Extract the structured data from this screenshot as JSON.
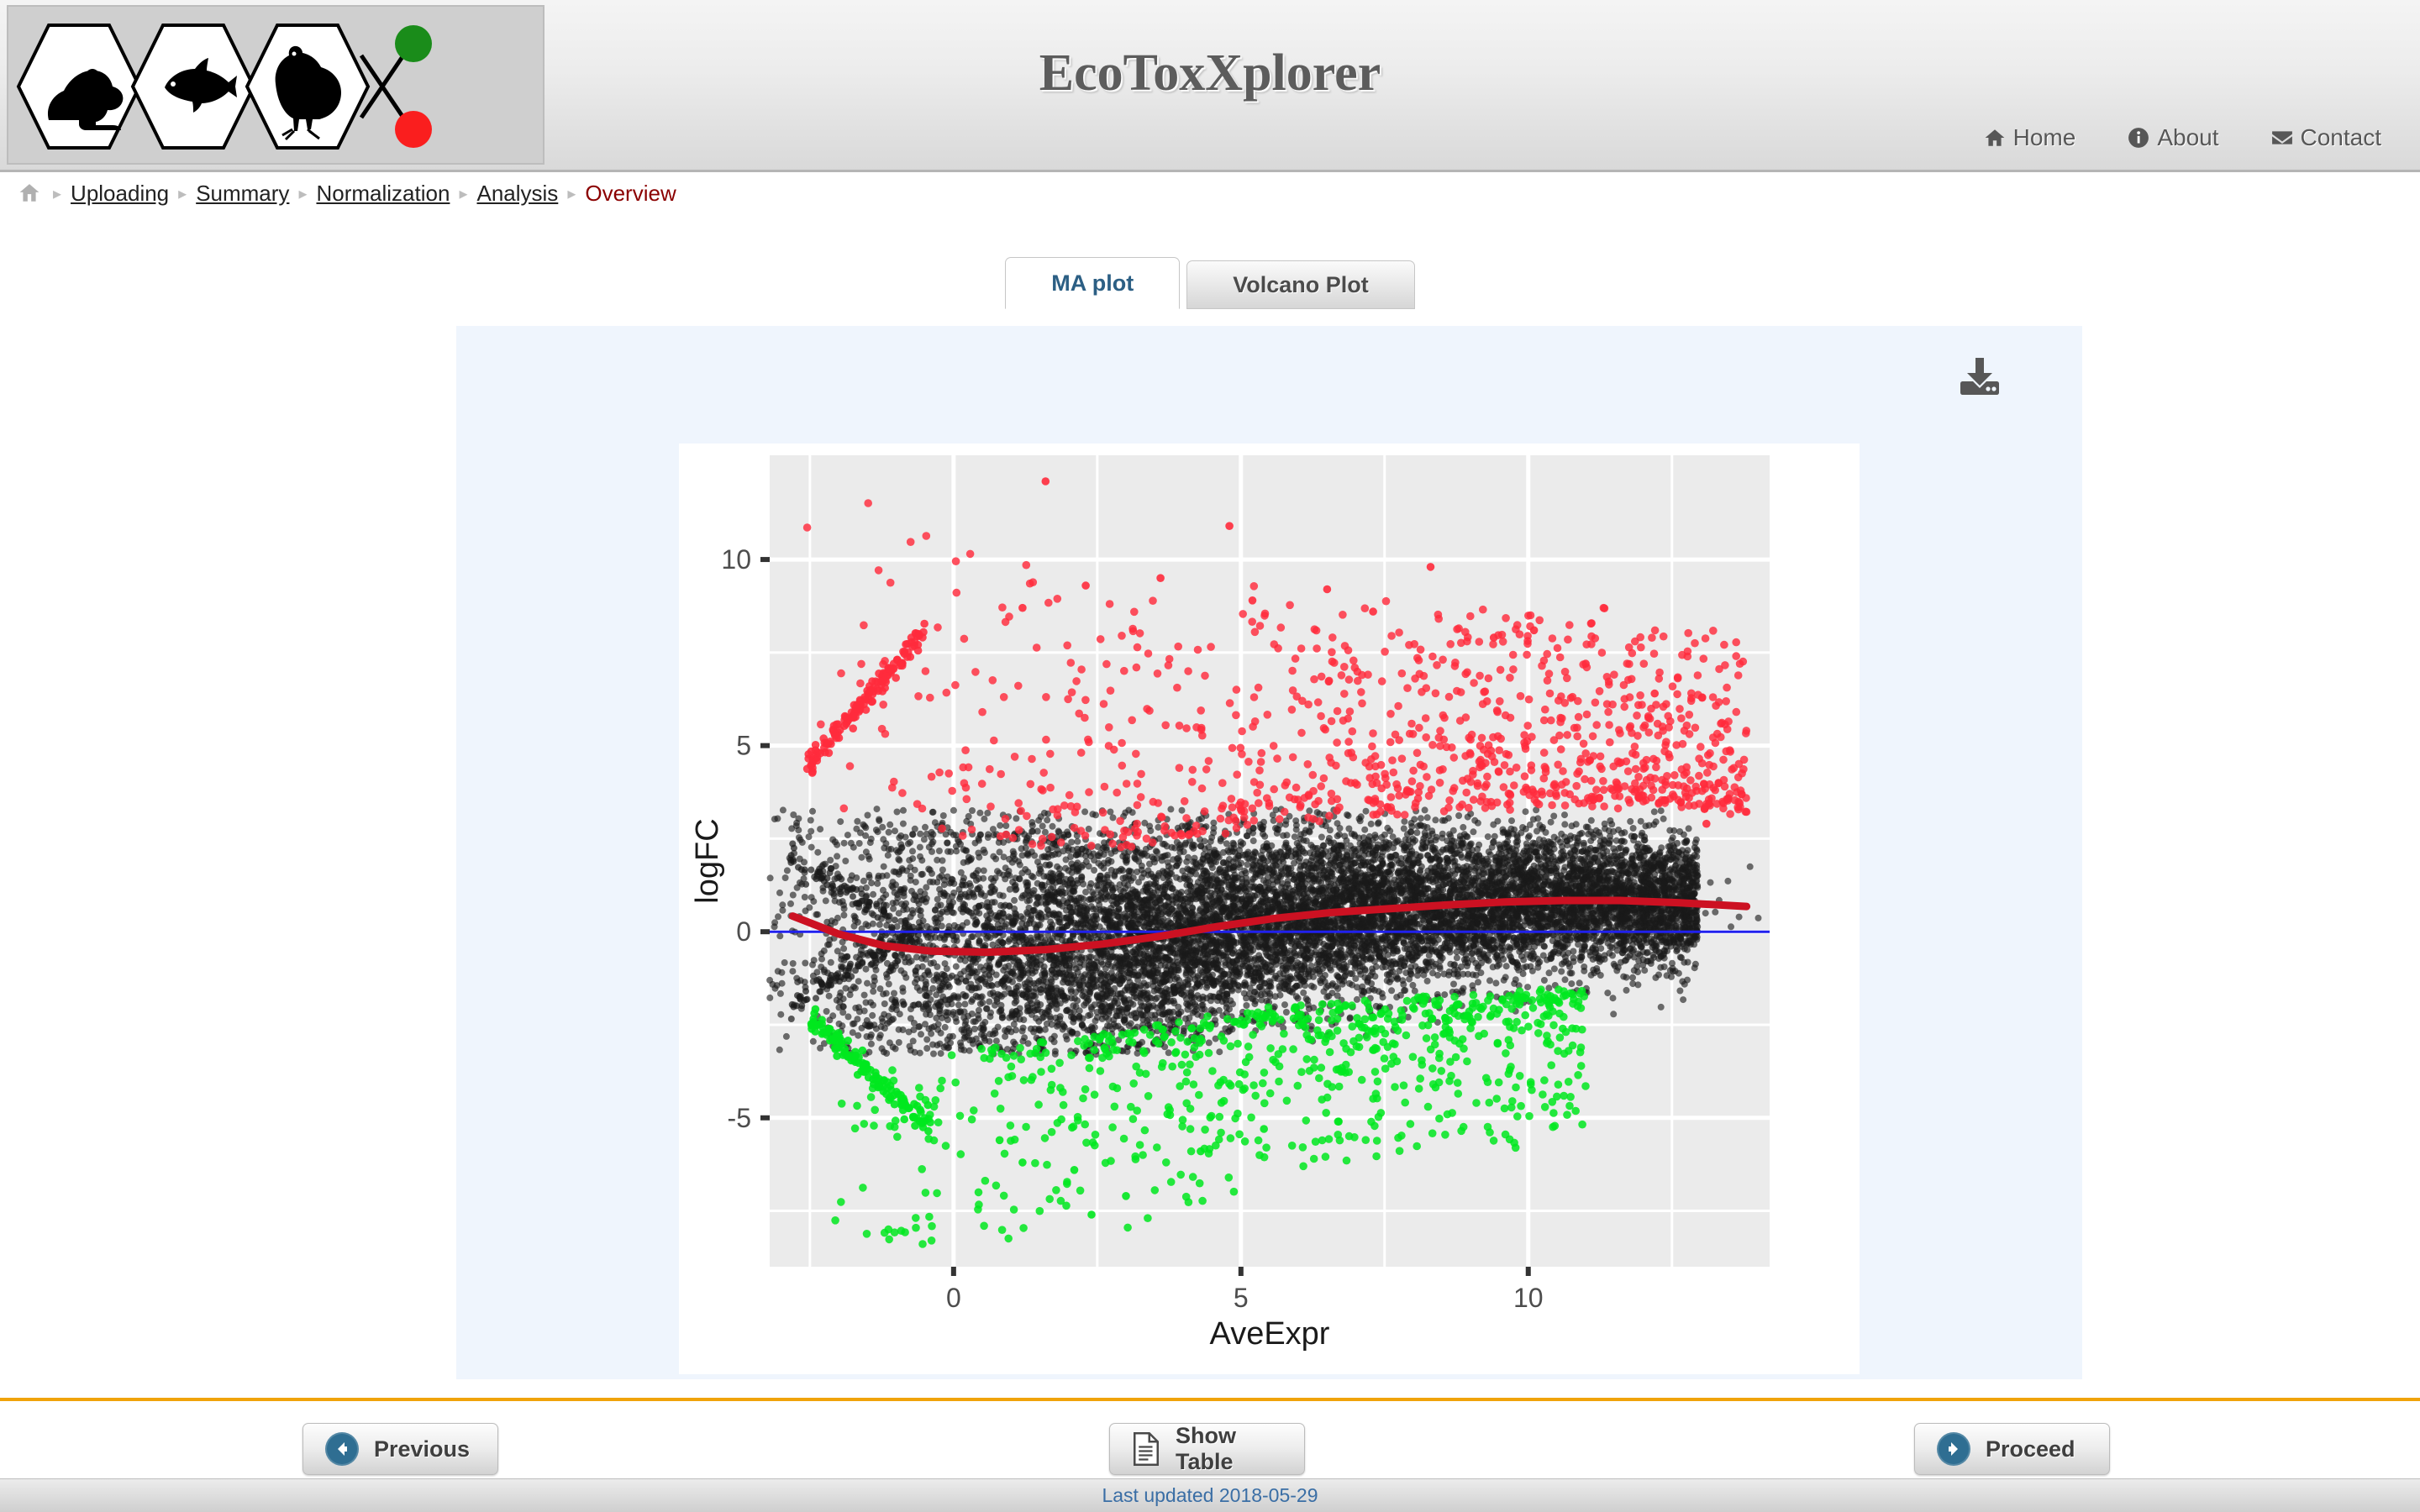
{
  "header": {
    "title": "EcoToxXplorer",
    "logo": {
      "hexagons": [
        "frog-silhouette",
        "fish-silhouette",
        "bird-silhouette"
      ],
      "green_dot_color": "#1a8c1a",
      "red_dot_color": "#fa1e1e"
    },
    "nav": [
      {
        "label": "Home",
        "icon": "home-icon"
      },
      {
        "label": "About",
        "icon": "info-icon"
      },
      {
        "label": "Contact",
        "icon": "envelope-icon"
      }
    ]
  },
  "breadcrumb": {
    "home_icon": "home-icon",
    "separator": "▸",
    "items": [
      {
        "label": "Uploading",
        "current": false
      },
      {
        "label": "Summary",
        "current": false
      },
      {
        "label": "Normalization",
        "current": false
      },
      {
        "label": "Analysis",
        "current": false
      },
      {
        "label": "Overview",
        "current": true
      }
    ]
  },
  "tabs": [
    {
      "label": "MA plot",
      "active": true
    },
    {
      "label": "Volcano Plot",
      "active": false
    }
  ],
  "plot_panel": {
    "download_icon": "download-icon",
    "background_color": "#eff5fd"
  },
  "buttons": {
    "previous": {
      "label": "Previous",
      "icon": "arrow-left-circle-icon"
    },
    "show_table": {
      "label": "Show Table",
      "icon": "file-document-icon"
    },
    "proceed": {
      "label": "Proceed",
      "icon": "arrow-right-circle-icon"
    }
  },
  "footer": {
    "text": "Last updated 2018-05-29",
    "color": "#3a6ea5"
  },
  "chart_data": {
    "type": "scatter",
    "title": "",
    "xlabel": "AveExpr",
    "ylabel": "logFC",
    "xlim": [
      -3.2,
      14.2
    ],
    "ylim": [
      -9.0,
      12.8
    ],
    "xticks": [
      0,
      5,
      10
    ],
    "yticks": [
      -5,
      0,
      5,
      10
    ],
    "grid": true,
    "panel_background": "#ebebeb",
    "gridline_color": "#ffffff",
    "legend": "none",
    "series": [
      {
        "name": "Up-regulated",
        "color": "#ff2b3c",
        "count_approx": 950,
        "description": "Significant positive logFC, above ~+2.5 threshold",
        "logfc_range": [
          2.3,
          12.2
        ],
        "aveexpr_range": [
          -2.6,
          13.9
        ]
      },
      {
        "name": "Not significant",
        "color": "#1a1a1a",
        "count_approx": 11000,
        "description": "Dense central cloud around logFC 0",
        "logfc_range": [
          -3.2,
          3.2
        ],
        "aveexpr_range": [
          -2.8,
          14.0
        ]
      },
      {
        "name": "Down-regulated",
        "color": "#00e81e",
        "count_approx": 700,
        "description": "Significant negative logFC, below ~-2.4 threshold",
        "logfc_range": [
          -8.4,
          -2.2
        ],
        "aveexpr_range": [
          -2.6,
          11.5
        ]
      }
    ],
    "reference_lines": [
      {
        "name": "zero-line",
        "type": "horizontal",
        "y": 0,
        "color": "#2020ee",
        "width": 3
      },
      {
        "name": "loess-trend",
        "type": "curve",
        "color": "#cc1122",
        "width": 9,
        "points": [
          {
            "x": -2.8,
            "y": 0.42
          },
          {
            "x": -2.0,
            "y": -0.06
          },
          {
            "x": -1.2,
            "y": -0.38
          },
          {
            "x": -0.4,
            "y": -0.52
          },
          {
            "x": 0.6,
            "y": -0.55
          },
          {
            "x": 1.6,
            "y": -0.48
          },
          {
            "x": 2.6,
            "y": -0.33
          },
          {
            "x": 3.6,
            "y": -0.12
          },
          {
            "x": 4.6,
            "y": 0.14
          },
          {
            "x": 5.6,
            "y": 0.36
          },
          {
            "x": 6.6,
            "y": 0.52
          },
          {
            "x": 7.6,
            "y": 0.62
          },
          {
            "x": 8.6,
            "y": 0.72
          },
          {
            "x": 9.6,
            "y": 0.8
          },
          {
            "x": 10.6,
            "y": 0.84
          },
          {
            "x": 11.6,
            "y": 0.84
          },
          {
            "x": 12.6,
            "y": 0.78
          },
          {
            "x": 13.8,
            "y": 0.68
          }
        ]
      }
    ]
  }
}
